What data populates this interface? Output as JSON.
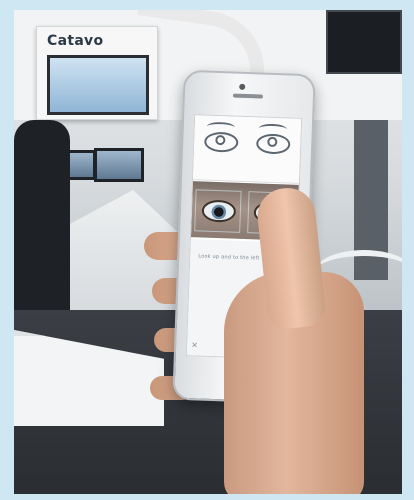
{
  "scene": {
    "booth_sign_text": "Catavo",
    "phone_screen_caption": "Look up and to the left",
    "close_glyph": "×"
  },
  "colors": {
    "frame_background": "#cfe6f3",
    "phone_body": "#f6f7f8",
    "skin": "#e2b79d"
  }
}
